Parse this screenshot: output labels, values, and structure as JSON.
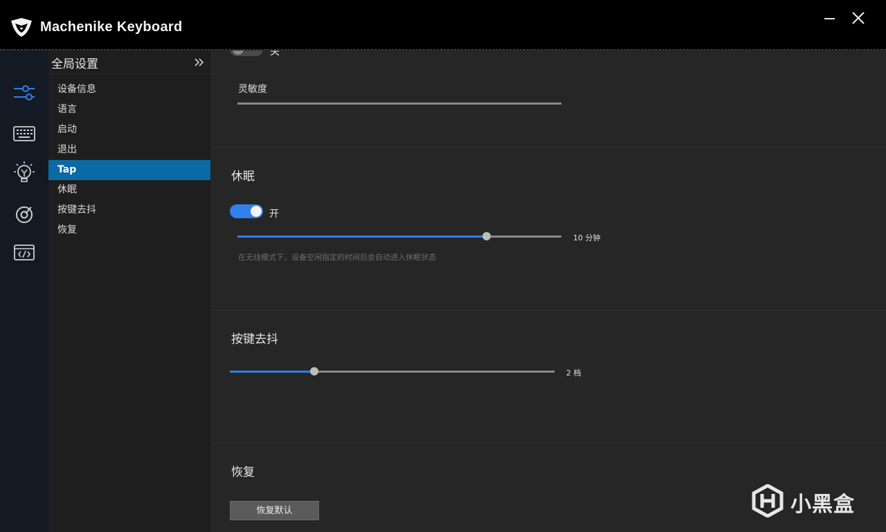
{
  "app": {
    "title": "Machenike Keyboard",
    "logo_icon": "machenike-logo-icon"
  },
  "window_controls": [
    "minimize-icon",
    "close-icon"
  ],
  "rail": {
    "items": [
      {
        "icon": "sliders-icon",
        "active": true
      },
      {
        "icon": "keyboard-icon",
        "active": false
      },
      {
        "icon": "lightbulb-icon",
        "active": false
      },
      {
        "icon": "target-icon",
        "active": false
      },
      {
        "icon": "code-window-icon",
        "active": false
      }
    ],
    "active_color": "#2f80ed"
  },
  "submenu": {
    "title": "全局设置",
    "collapse_icon": "double-chevron-right-icon",
    "items": [
      {
        "label": "设备信息",
        "active": false
      },
      {
        "label": "语言",
        "active": false
      },
      {
        "label": "启动",
        "active": false
      },
      {
        "label": "退出",
        "active": false
      },
      {
        "label": "Tap",
        "active": true
      },
      {
        "label": "休眠",
        "active": false
      },
      {
        "label": "按键去抖",
        "active": false
      },
      {
        "label": "恢复",
        "active": false
      }
    ],
    "active_color": "#0b6aa3"
  },
  "tap": {
    "toggle_label": "关",
    "toggle_on": false,
    "sensitivity_label": "灵敏度"
  },
  "sleep": {
    "title": "休眠",
    "toggle_label": "开",
    "toggle_on": true,
    "slider_fraction": 0.77,
    "slider_value": "10 分钟",
    "hint": "在无线模式下，设备空闲指定的时间后会自动进入休眠状态"
  },
  "debounce": {
    "title": "按键去抖",
    "slider_fraction": 0.26,
    "slider_value": "2 档"
  },
  "restore": {
    "title": "恢复",
    "button_label": "恢复默认"
  },
  "watermark": {
    "text": "小黑盒",
    "icon": "xiaoheihe-logo-icon"
  }
}
